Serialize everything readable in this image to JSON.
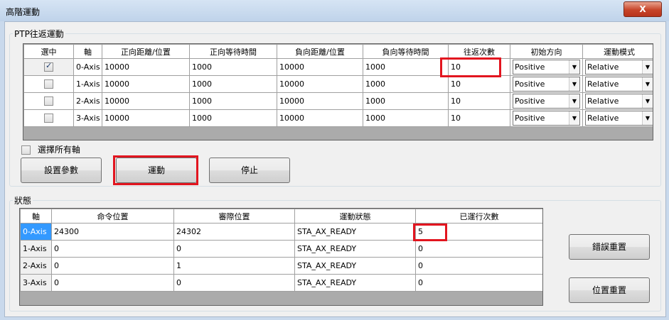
{
  "window": {
    "title": "高階運動",
    "close_label": "X"
  },
  "ptp": {
    "group_title": "PTP往返運動",
    "columns": [
      "選中",
      "軸",
      "正向距離/位置",
      "正向等待時間",
      "負向距離/位置",
      "負向等待時間",
      "往返次數",
      "初始方向",
      "運動模式"
    ],
    "rows": [
      {
        "checked": true,
        "axis": "0-Axis",
        "pos_dist": "10000",
        "pos_wait": "1000",
        "neg_dist": "10000",
        "neg_wait": "1000",
        "count": "10",
        "direction": "Positive",
        "mode": "Relative"
      },
      {
        "checked": false,
        "axis": "1-Axis",
        "pos_dist": "10000",
        "pos_wait": "1000",
        "neg_dist": "10000",
        "neg_wait": "1000",
        "count": "10",
        "direction": "Positive",
        "mode": "Relative"
      },
      {
        "checked": false,
        "axis": "2-Axis",
        "pos_dist": "10000",
        "pos_wait": "1000",
        "neg_dist": "10000",
        "neg_wait": "1000",
        "count": "10",
        "direction": "Positive",
        "mode": "Relative"
      },
      {
        "checked": false,
        "axis": "3-Axis",
        "pos_dist": "10000",
        "pos_wait": "1000",
        "neg_dist": "10000",
        "neg_wait": "1000",
        "count": "10",
        "direction": "Positive",
        "mode": "Relative"
      }
    ],
    "select_all_label": "選擇所有軸",
    "buttons": {
      "set_params": "設置參數",
      "move": "運動",
      "stop": "停止"
    }
  },
  "status": {
    "group_title": "狀態",
    "columns": [
      "軸",
      "命令位置",
      "審際位置",
      "運動狀態",
      "已運行次數"
    ],
    "rows": [
      {
        "axis": "0-Axis",
        "cmd": "24300",
        "actual": "24302",
        "state": "STA_AX_READY",
        "runs": "5"
      },
      {
        "axis": "1-Axis",
        "cmd": "0",
        "actual": "0",
        "state": "STA_AX_READY",
        "runs": "0"
      },
      {
        "axis": "2-Axis",
        "cmd": "0",
        "actual": "1",
        "state": "STA_AX_READY",
        "runs": "0"
      },
      {
        "axis": "3-Axis",
        "cmd": "0",
        "actual": "0",
        "state": "STA_AX_READY",
        "runs": "0"
      }
    ],
    "buttons": {
      "error_reset": "錯誤重置",
      "position_reset": "位置重置"
    }
  },
  "colors": {
    "highlight": "#e2151f",
    "selected_row_header": "#3399ff"
  }
}
